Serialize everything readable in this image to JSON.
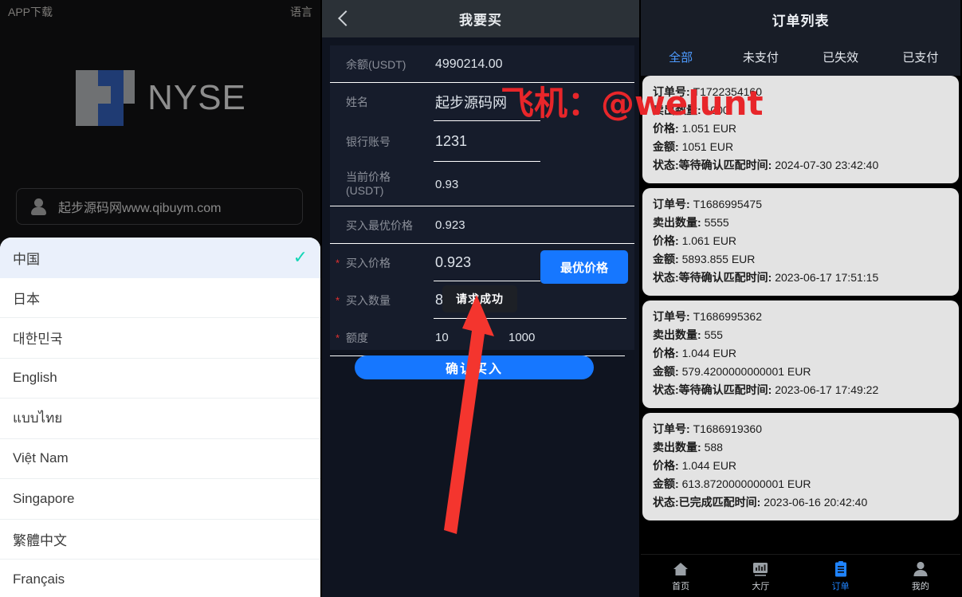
{
  "left_panel": {
    "topbar": {
      "app_download": "APP下载",
      "language": "语言"
    },
    "logo": {
      "text": "NYSE",
      "gray": "#6f7173",
      "blue": "#1f3b73"
    },
    "user_field": {
      "value": "起步源码网www.qibuym.com",
      "icon": "user-icon"
    },
    "language_list": [
      {
        "label": "中国",
        "selected": true,
        "check": "✓"
      },
      {
        "label": "日本",
        "selected": false
      },
      {
        "label": "대한민국",
        "selected": false
      },
      {
        "label": "English",
        "selected": false
      },
      {
        "label": "แบบไทย",
        "selected": false
      },
      {
        "label": "Việt Nam",
        "selected": false
      },
      {
        "label": "Singapore",
        "selected": false
      },
      {
        "label": "繁體中文",
        "selected": false
      },
      {
        "label": "Français",
        "selected": false
      }
    ]
  },
  "mid_panel": {
    "header": {
      "title": "我要买",
      "back_icon": "chevron-left-icon"
    },
    "fields": {
      "balance_label": "余额(USDT)",
      "balance_value": "4990214.00",
      "name_label": "姓名",
      "name_value": "起步源码网",
      "bank_label": "银行账号",
      "bank_value": "1231",
      "current_price_label": "当前价格\n(USDT)",
      "current_price_label_l1": "当前价格",
      "current_price_label_l2": "(USDT)",
      "current_price_value": "0.93",
      "best_price_label": "买入最优价格",
      "best_price_value": "0.923",
      "buy_price_label": "买入价格",
      "buy_price_value": "0.923",
      "buy_qty_label": "买入数量",
      "buy_qty_value": "88",
      "quota_label": "额度",
      "quota_min": "10",
      "quota_max": "1000",
      "required_marker": "*"
    },
    "best_price_button": "最优价格",
    "confirm_button": "确认买入",
    "toast": "请求成功",
    "accent": "#1677ff"
  },
  "right_panel": {
    "header": {
      "title": "订单列表"
    },
    "tabs": [
      {
        "label": "全部",
        "active": true
      },
      {
        "label": "未支付",
        "active": false
      },
      {
        "label": "已失效",
        "active": false
      },
      {
        "label": "已支付",
        "active": false
      }
    ],
    "labels": {
      "order_no": "订单号:",
      "sell_qty": "卖出数量:",
      "price": "价格:",
      "amount": "金额:",
      "status": "状态:",
      "match_time": "匹配时间:"
    },
    "orders": [
      {
        "order_no": "T1722354160",
        "sell_qty": "1000",
        "price": "1.051 EUR",
        "amount": "1051 EUR",
        "status": "等待确认",
        "match_time": "2024-07-30 23:42:40"
      },
      {
        "order_no": "T1686995475",
        "sell_qty": "5555",
        "price": "1.061 EUR",
        "amount": "5893.855 EUR",
        "status": "等待确认",
        "match_time": "2023-06-17 17:51:15"
      },
      {
        "order_no": "T1686995362",
        "sell_qty": "555",
        "price": "1.044 EUR",
        "amount": "579.4200000000001 EUR",
        "status": "等待确认",
        "match_time": "2023-06-17 17:49:22"
      },
      {
        "order_no": "T1686919360",
        "sell_qty": "588",
        "price": "1.044 EUR",
        "amount": "613.8720000000001 EUR",
        "status": "已完成",
        "match_time": "2023-06-16 20:42:40"
      }
    ],
    "bottom_nav": [
      {
        "label": "首页",
        "icon": "home-icon",
        "active": false
      },
      {
        "label": "大厅",
        "icon": "chart-icon",
        "active": false
      },
      {
        "label": "订单",
        "icon": "clipboard-icon",
        "active": true
      },
      {
        "label": "我的",
        "icon": "person-icon",
        "active": false
      }
    ],
    "active_color": "#1f84ff"
  },
  "overlay": {
    "watermark": "飞机：@welunt",
    "watermark_color": "#e8262a",
    "arrow_color": "#f4352e"
  }
}
